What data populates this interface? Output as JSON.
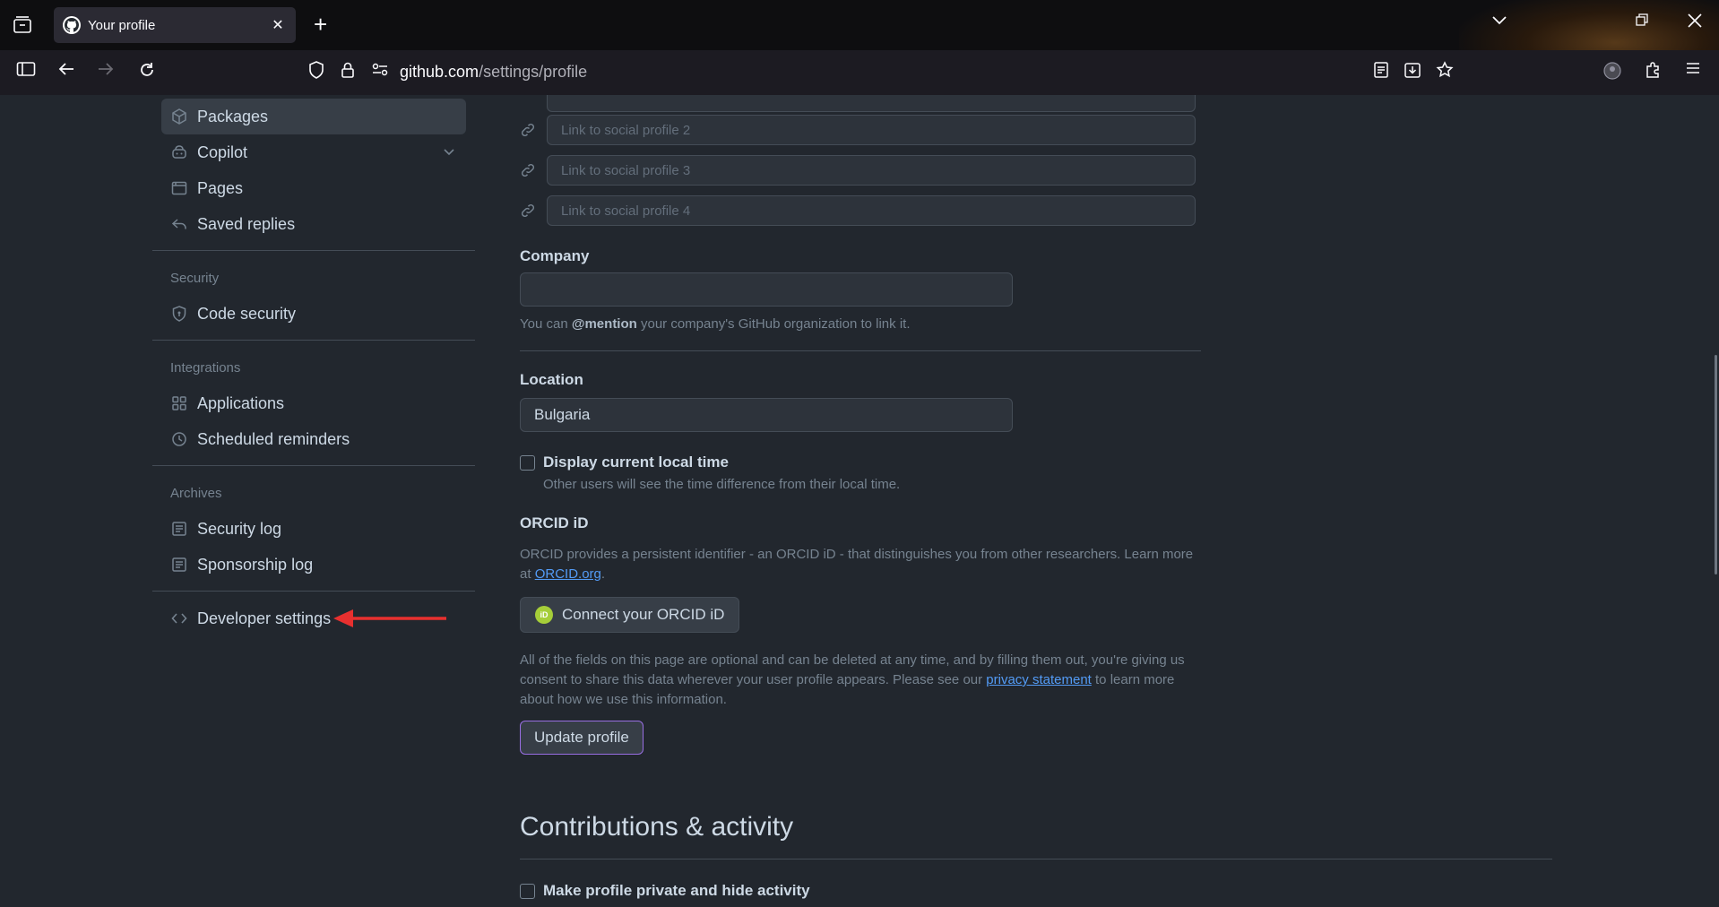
{
  "browser": {
    "tab_title": "Your profile",
    "url_domain": "github.com",
    "url_path": "/settings/profile"
  },
  "sidebar": {
    "items_top": [
      {
        "label": "Packages",
        "icon": "package-icon",
        "active": true
      },
      {
        "label": "Copilot",
        "icon": "copilot-icon",
        "expandable": true
      },
      {
        "label": "Pages",
        "icon": "browser-icon"
      },
      {
        "label": "Saved replies",
        "icon": "reply-icon"
      }
    ],
    "security_heading": "Security",
    "code_security": "Code security",
    "integrations_heading": "Integrations",
    "applications": "Applications",
    "scheduled_reminders": "Scheduled reminders",
    "archives_heading": "Archives",
    "security_log": "Security log",
    "sponsorship_log": "Sponsorship log",
    "developer_settings": "Developer settings"
  },
  "profile": {
    "social_placeholders": [
      "Link to social profile 2",
      "Link to social profile 3",
      "Link to social profile 4"
    ],
    "company_label": "Company",
    "company_value": "",
    "company_note_pre": "You can ",
    "company_note_mention": "@mention",
    "company_note_post": " your company's GitHub organization to link it.",
    "location_label": "Location",
    "location_value": "Bulgaria",
    "local_time_label": "Display current local time",
    "local_time_note": "Other users will see the time difference from their local time.",
    "orcid_heading": "ORCID iD",
    "orcid_text": "ORCID provides a persistent identifier - an ORCID iD - that distinguishes you from other researchers. Learn more at",
    "orcid_link": "ORCID.org",
    "orcid_button": "Connect your ORCID iD",
    "orcid_logo_text": "iD",
    "disclaimer_pre": "All of the fields on this page are optional and can be deleted at any time, and by filling them out, you're giving us consent to share this data wherever your user profile appears. Please see our ",
    "disclaimer_link": "privacy statement",
    "disclaimer_post": " to learn more about how we use this information.",
    "update_button": "Update profile",
    "contributions_title": "Contributions & activity",
    "private_label": "Make profile private and hide activity"
  },
  "colors": {
    "annotation_arrow": "#e8302f",
    "accent_link": "#539bf5"
  }
}
